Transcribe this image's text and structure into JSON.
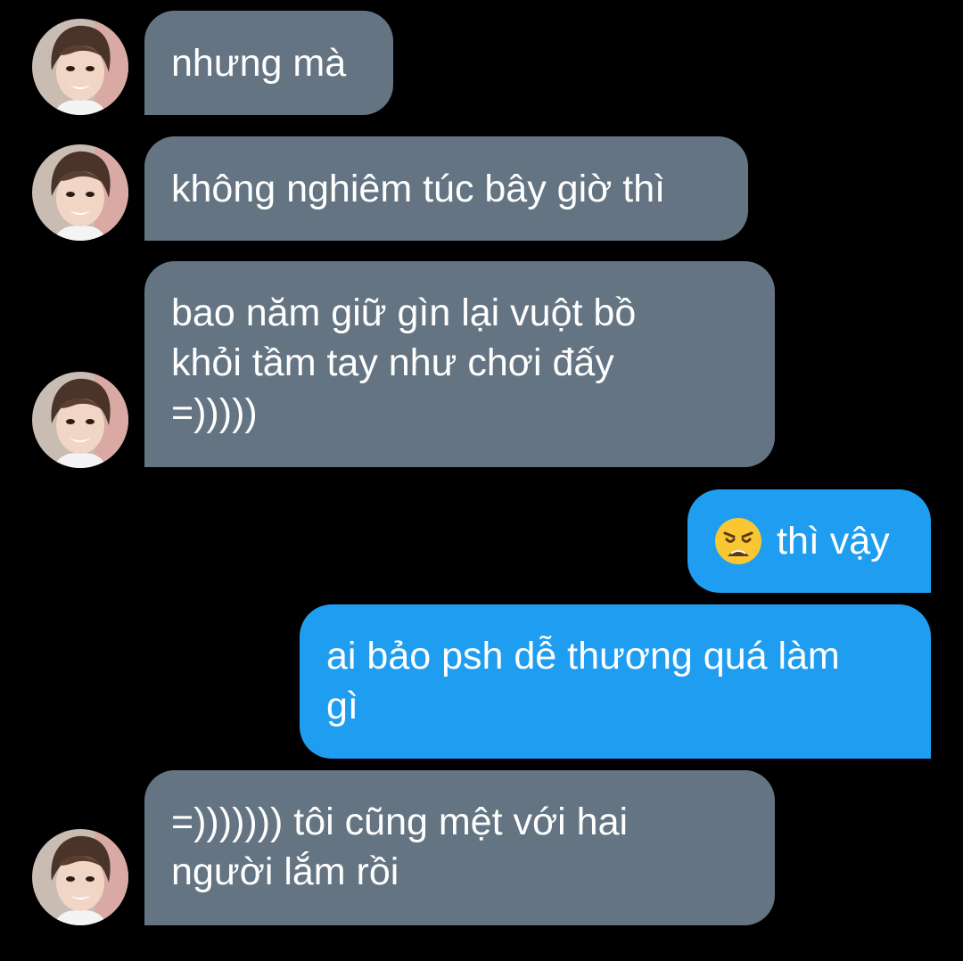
{
  "messages": [
    {
      "side": "incoming",
      "text": "nhưng mà"
    },
    {
      "side": "incoming",
      "text": "không nghiêm túc bây giờ thì"
    },
    {
      "side": "incoming",
      "lines": [
        "bao năm giữ gìn lại vuột bồ",
        "khỏi tầm tay như chơi đấy",
        "=)))))"
      ]
    },
    {
      "side": "outgoing",
      "emoji": "weary-face",
      "text": "thì vậy"
    },
    {
      "side": "outgoing",
      "lines": [
        "ai bảo psh dễ thương quá làm",
        "gì"
      ]
    },
    {
      "side": "incoming",
      "lines": [
        "=))))))) tôi cũng mệt với hai",
        "người lắm rồi"
      ]
    }
  ],
  "colors": {
    "incoming_bubble": "#647482",
    "outgoing_bubble": "#1f9ef1",
    "background": "#000000"
  }
}
